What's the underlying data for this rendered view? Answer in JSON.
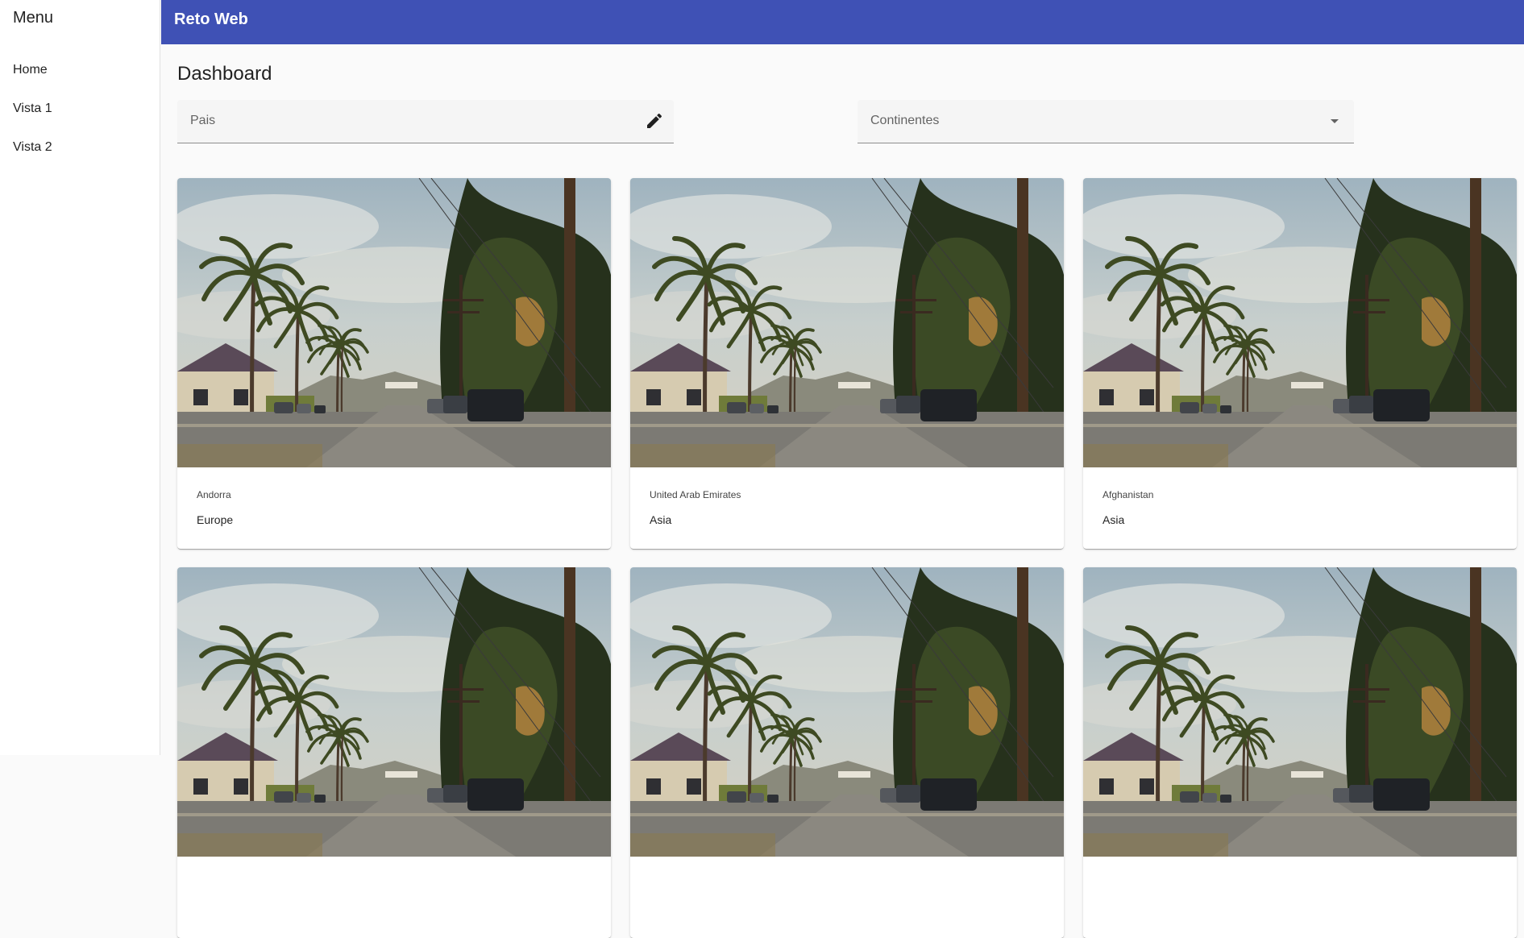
{
  "sidebar": {
    "title": "Menu",
    "items": [
      {
        "label": "Home"
      },
      {
        "label": "Vista 1"
      },
      {
        "label": "Vista 2"
      }
    ]
  },
  "toolbar": {
    "title": "Reto Web"
  },
  "main": {
    "title": "Dashboard",
    "filters": {
      "country": {
        "label": "Pais",
        "value": "",
        "icon": "edit-icon"
      },
      "continent": {
        "label": "Continentes",
        "selected": "",
        "icon": "dropdown-arrow-icon"
      }
    },
    "cards": [
      {
        "country": "Andorra",
        "continent": "Europe"
      },
      {
        "country": "United Arab Emirates",
        "continent": "Asia"
      },
      {
        "country": "Afghanistan",
        "continent": "Asia"
      },
      {
        "country": "",
        "continent": ""
      },
      {
        "country": "",
        "continent": ""
      },
      {
        "country": "",
        "continent": ""
      }
    ]
  },
  "colors": {
    "primary": "#3f51b5",
    "background": "#fafafa",
    "field": "#f5f5f5"
  }
}
